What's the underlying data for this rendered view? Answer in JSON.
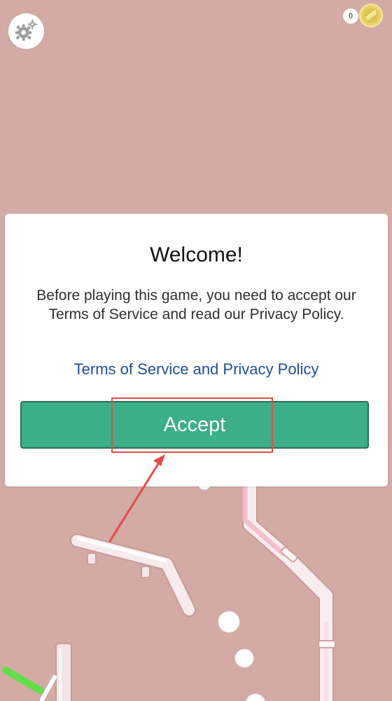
{
  "dialog": {
    "title": "Welcome!",
    "message": "Before playing this game, you need to accept our Terms of Service and read our Privacy Policy.",
    "link_label": "Terms of Service and Privacy Policy",
    "accept_label": "Accept"
  },
  "hud": {
    "counter_value": "0",
    "settings_icon": "gear-icon",
    "coin_icon": "coin-icon"
  },
  "colors": {
    "background": "#d3aaa4",
    "accept_button": "#3aaf88",
    "accept_border": "#2f6e59",
    "link": "#1c4f9c",
    "annotation": "#e84a4a",
    "coin": "#e9d36b"
  }
}
